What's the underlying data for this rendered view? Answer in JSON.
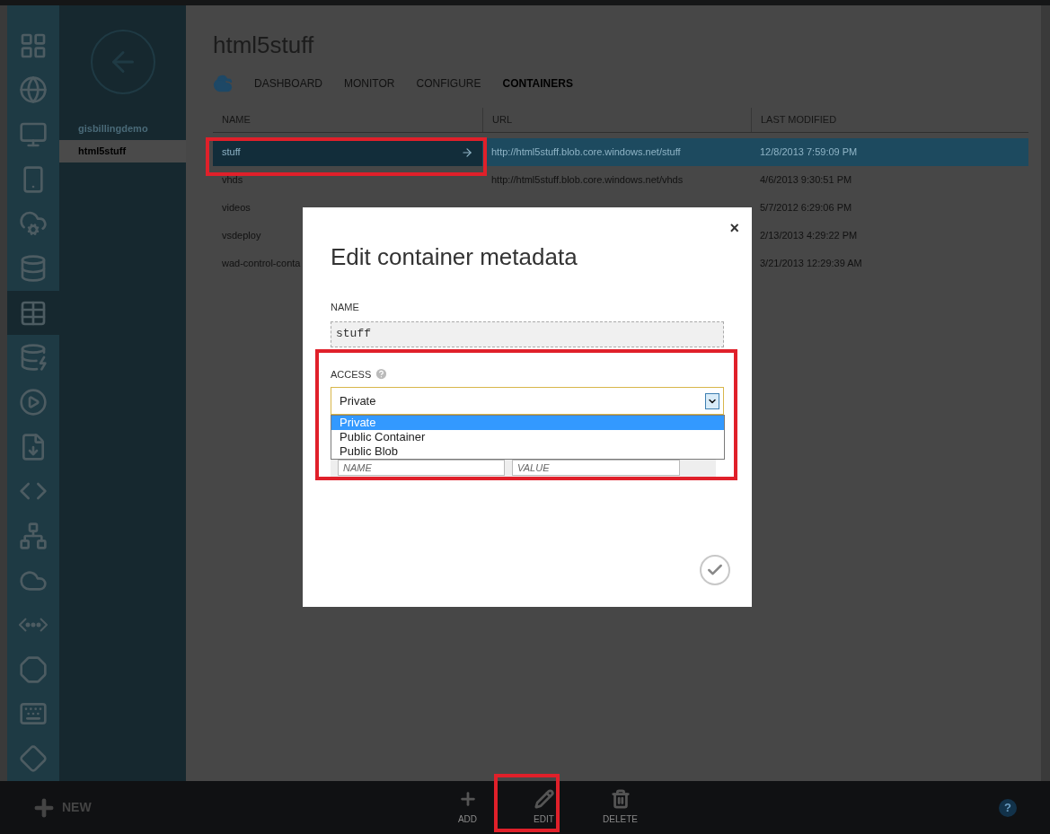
{
  "rail": [
    {
      "selected": false
    },
    {
      "selected": false
    },
    {
      "selected": false
    },
    {
      "selected": false
    },
    {
      "selected": false
    },
    {
      "selected": false
    },
    {
      "selected": true
    },
    {
      "selected": false
    },
    {
      "selected": false
    },
    {
      "selected": false
    },
    {
      "selected": false
    },
    {
      "selected": false
    },
    {
      "selected": false
    },
    {
      "selected": false
    },
    {
      "selected": false
    },
    {
      "selected": false
    },
    {
      "selected": false
    }
  ],
  "subnav": {
    "items": [
      {
        "label": "gisbillingdemo",
        "selected": false
      },
      {
        "label": "html5stuff",
        "selected": true
      }
    ]
  },
  "page": {
    "title": "html5stuff"
  },
  "tabs": [
    {
      "label": "DASHBOARD",
      "selected": false
    },
    {
      "label": "MONITOR",
      "selected": false
    },
    {
      "label": "CONFIGURE",
      "selected": false
    },
    {
      "label": "CONTAINERS",
      "selected": true
    }
  ],
  "table": {
    "columns": [
      "NAME",
      "URL",
      "LAST MODIFIED"
    ],
    "rows": [
      {
        "name": "stuff",
        "url": "http://html5stuff.blob.core.windows.net/stuff",
        "modified": "12/8/2013 7:59:09 PM",
        "selected": true
      },
      {
        "name": "vhds",
        "url": "http://html5stuff.blob.core.windows.net/vhds",
        "modified": "4/6/2013 9:30:51 PM",
        "selected": false
      },
      {
        "name": "videos",
        "modified": "5/7/2012 6:29:06 PM",
        "selected": false
      },
      {
        "name": "vsdeploy",
        "modified": "2/13/2013 4:29:22 PM",
        "selected": false
      },
      {
        "name": "wad-control-conta",
        "modified": "3/21/2013 12:29:39 AM",
        "selected": false
      }
    ]
  },
  "dialog": {
    "title": "Edit container metadata",
    "close": "×",
    "name_label": "NAME",
    "name_value": "stuff",
    "access_label": "ACCESS",
    "access_value": "Private",
    "access_options": [
      {
        "label": "Private",
        "selected": true
      },
      {
        "label": "Public Container",
        "selected": false
      },
      {
        "label": "Public Blob",
        "selected": false
      }
    ],
    "metadata_name_placeholder": "NAME",
    "metadata_value_placeholder": "VALUE"
  },
  "command_bar": {
    "new": "NEW",
    "help": "?",
    "actions": [
      {
        "label": "ADD",
        "kind": "add"
      },
      {
        "label": "EDIT",
        "kind": "edit"
      },
      {
        "label": "DELETE",
        "kind": "delete"
      }
    ]
  }
}
